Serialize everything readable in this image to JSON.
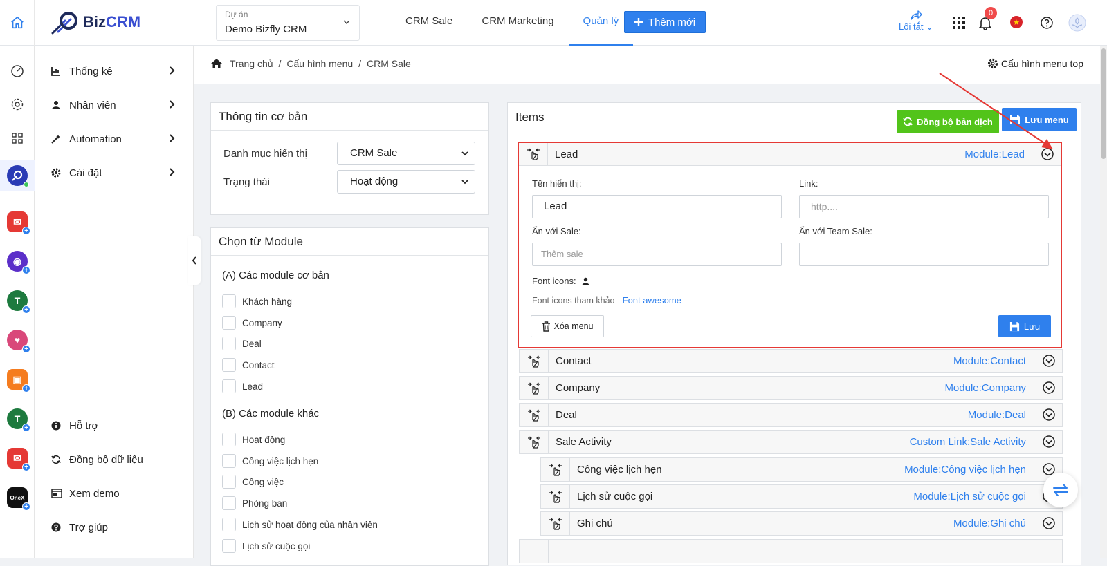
{
  "header": {
    "logo_prefix": "Biz",
    "logo_suffix": "CRM",
    "project_label": "Dự án",
    "project_value": "Demo Bizfly CRM",
    "nav": [
      "CRM Sale",
      "CRM Marketing",
      "Quản lý"
    ],
    "add_button": "Thêm mới",
    "shortcut_label": "Lối tắt",
    "notification_count": "0",
    "accent_color": "#2f80ed"
  },
  "rail": {
    "icons": [
      "home-icon",
      "dashboard-icon",
      "settings-icon",
      "apps-grid-icon",
      "bizcrm-app-icon",
      "mail-app-icon",
      "chat-app-icon",
      "tasks-app-icon",
      "heart-app-icon",
      "shop-app-icon",
      "tasks2-app-icon",
      "mail2-app-icon",
      "onex-app-icon"
    ],
    "onex_label": "OneX"
  },
  "sidebar": {
    "items": [
      {
        "label": "Thống kê",
        "icon": "chart-icon"
      },
      {
        "label": "Nhân viên",
        "icon": "user-icon"
      },
      {
        "label": "Automation",
        "icon": "magic-icon"
      },
      {
        "label": "Cài đặt",
        "icon": "gear-icon"
      }
    ],
    "bottom": [
      {
        "label": "Hỗ trợ",
        "icon": "info-icon"
      },
      {
        "label": "Đồng bộ dữ liệu",
        "icon": "sync-icon"
      },
      {
        "label": "Xem demo",
        "icon": "demo-icon"
      },
      {
        "label": "Trợ giúp",
        "icon": "help-icon"
      }
    ]
  },
  "breadcrumb": {
    "items": [
      "Trang chủ",
      "Cấu hình menu",
      "CRM Sale"
    ],
    "separator": "/",
    "config_top": "Cấu hình menu top"
  },
  "basic_info": {
    "title": "Thông tin cơ bản",
    "category_label": "Danh mục hiển thị",
    "category_value": "CRM Sale",
    "status_label": "Trạng thái",
    "status_value": "Hoạt động"
  },
  "modules": {
    "title": "Chọn từ Module",
    "group_a": "(A) Các module cơ bản",
    "group_a_items": [
      "Khách hàng",
      "Company",
      "Deal",
      "Contact",
      "Lead"
    ],
    "group_b": "(B) Các module khác",
    "group_b_items": [
      "Hoạt động",
      "Công việc lịch hẹn",
      "Công việc",
      "Phòng ban",
      "Lịch sử hoạt động của nhân viên",
      "Lịch sử cuộc gọi"
    ]
  },
  "items": {
    "title": "Items",
    "sync_button": "Đồng bộ bản dịch",
    "save_menu_button": "Lưu menu",
    "expanded": {
      "name": "Lead",
      "module": "Module:Lead",
      "display_name_label": "Tên hiển thị:",
      "display_name_value": "Lead",
      "link_label": "Link:",
      "link_placeholder": "http....",
      "hide_sale_label": "Ẩn với Sale:",
      "hide_sale_placeholder": "Thêm sale",
      "hide_team_label": "Ẩn với Team Sale:",
      "hide_team_value": "",
      "font_icons_label": "Font icons:",
      "font_ref_text": "Font icons tham khảo -",
      "font_ref_link": "Font awesome",
      "delete_button": "Xóa menu",
      "save_button": "Lưu"
    },
    "rows": [
      {
        "name": "Contact",
        "module": "Module:Contact"
      },
      {
        "name": "Company",
        "module": "Module:Company"
      },
      {
        "name": "Deal",
        "module": "Module:Deal"
      },
      {
        "name": "Sale Activity",
        "module": "Custom Link:Sale Activity"
      }
    ],
    "children": [
      {
        "name": "Công việc lịch hẹn",
        "module": "Module:Công việc lịch hẹn"
      },
      {
        "name": "Lịch sử cuộc gọi",
        "module": "Module:Lịch sử cuộc gọi"
      },
      {
        "name": "Ghi chú",
        "module": "Module:Ghi chú"
      }
    ]
  },
  "annotation_color": "#e53935"
}
